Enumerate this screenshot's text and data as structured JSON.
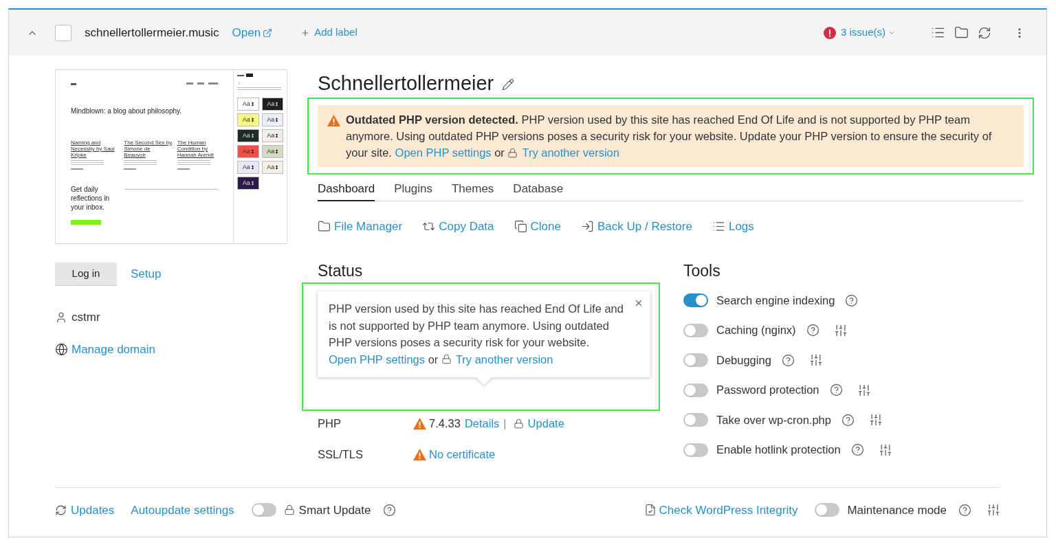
{
  "header": {
    "checked": false,
    "domain": "schnellertollermeier.music",
    "open_link": "Open",
    "add_label": "Add label",
    "issues": "3 issue(s)"
  },
  "preview": {
    "heading": "Mindblown: a blog about philosophy.",
    "posts": [
      "Naming and Necessity by Saul Kripke",
      "The Second Sex by Simone de Beauvoir",
      "The Human Condition by Hannah Arendt"
    ],
    "cta": "Get daily reflections in your inbox.",
    "swatches": [
      {
        "label": "Aa",
        "color": "#ffffff"
      },
      {
        "label": "Aa",
        "color": "#1f1f1f"
      },
      {
        "label": "Aa",
        "color": "#f8fa7e"
      },
      {
        "label": "Aa",
        "color": "#eceef8"
      },
      {
        "label": "Aa",
        "color": "#1e2a26"
      },
      {
        "label": "Aa",
        "color": "#f1eee8"
      },
      {
        "label": "Aa",
        "color": "#f2514b"
      },
      {
        "label": "Aa",
        "color": "#d8d9c2"
      },
      {
        "label": "Aa",
        "color": "#e7e8f3"
      },
      {
        "label": "Aa",
        "color": "#f3f0e6"
      },
      {
        "label": "Aa",
        "color": "#2d1a4a"
      }
    ]
  },
  "left": {
    "login": "Log in",
    "setup": "Setup",
    "user": "cstmr",
    "manage_domain": "Manage domain"
  },
  "site_title": "Schnellertollermeier",
  "warning": {
    "bold": "Outdated PHP version detected.",
    "text": "PHP version used by this site has reached End Of Life and is not supported by PHP team anymore. Using outdated PHP versions poses a security risk for your website. Update your PHP version to ensure the security of your site.",
    "link": "Open PHP settings",
    "or": "or",
    "locked_link": "Try another version"
  },
  "tabs": [
    {
      "label": "Dashboard",
      "selected": true
    },
    {
      "label": "Plugins",
      "selected": false
    },
    {
      "label": "Themes",
      "selected": false
    },
    {
      "label": "Database",
      "selected": false
    }
  ],
  "actions": [
    "File Manager",
    "Copy Data",
    "Clone",
    "Back Up / Restore",
    "Logs"
  ],
  "status": {
    "title": "Status",
    "popover": {
      "text": "PHP version used by this site has reached End Of Life and is not supported by PHP team anymore. Using outdated PHP versions poses a security risk for your website.",
      "link": "Open PHP settings",
      "or": "or",
      "locked_link": "Try another version"
    },
    "rows": [
      {
        "label": "PHP",
        "parts": [
          {
            "kind": "text",
            "text": "7.4.33"
          },
          {
            "kind": "link",
            "text": "Details"
          },
          {
            "kind": "sep",
            "text": "|"
          },
          {
            "kind": "locked_link",
            "text": "Update"
          }
        ]
      },
      {
        "label": "SSL/TLS",
        "parts": [
          {
            "kind": "link",
            "text": "No certificate"
          }
        ]
      }
    ]
  },
  "tools": {
    "title": "Tools",
    "items": [
      {
        "label": "Search engine indexing",
        "on": true,
        "settings": false
      },
      {
        "label": "Caching (nginx)",
        "on": false,
        "settings": true
      },
      {
        "label": "Debugging",
        "on": false,
        "settings": true
      },
      {
        "label": "Password protection",
        "on": false,
        "settings": true
      },
      {
        "label": "Take over wp-cron.php",
        "on": false,
        "settings": true
      },
      {
        "label": "Enable hotlink protection",
        "on": false,
        "settings": true
      }
    ]
  },
  "footer": {
    "updates": "Updates",
    "autoupdate": "Autoupdate settings",
    "smart_update": {
      "label": "Smart Update",
      "on": false
    },
    "integrity": "Check WordPress Integrity",
    "maintenance": {
      "label": "Maintenance mode",
      "on": false
    }
  }
}
